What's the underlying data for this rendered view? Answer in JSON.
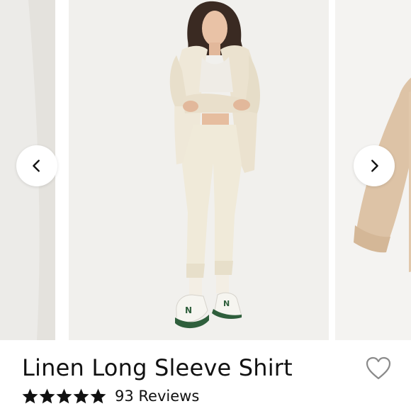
{
  "product": {
    "title": "Linen Long Sleeve Shirt",
    "rating": {
      "stars": 5,
      "max_stars": 5,
      "reviews_label": "93 Reviews"
    }
  },
  "carousel": {
    "prev_icon": "chevron-left-icon",
    "next_icon": "chevron-right-icon",
    "favorite_icon": "heart-outline-icon"
  },
  "colors": {
    "text": "#111111",
    "star": "#111111",
    "slide_background": "#f1f0ed",
    "garment": "#efe8d8",
    "shirt_next": "#ddc3a6"
  }
}
